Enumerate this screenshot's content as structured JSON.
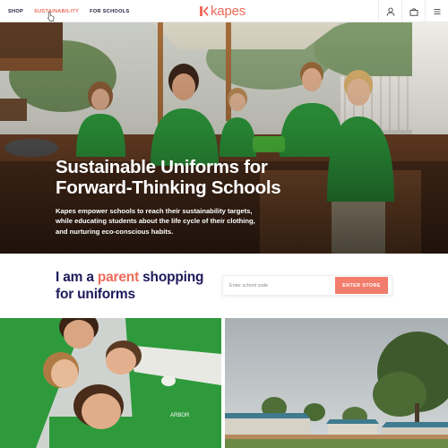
{
  "header": {
    "nav": [
      {
        "label": "SHOP",
        "active": false
      },
      {
        "label": "SUSTAINABILITY",
        "active": true
      },
      {
        "label": "FOR SCHOOLS",
        "active": false
      }
    ],
    "logo_text": "kapes",
    "icons": [
      "account-icon",
      "cart-icon",
      "menu-icon"
    ]
  },
  "hero": {
    "title_line1": "Sustainable Uniforms for",
    "title_line2": "Forward-Thinking Schools",
    "text_line1": "Kapes empower schools to reach their sustainability targets,",
    "text_line2": "while educating students about the life cycle of their clothing,",
    "text_line3": "and nurturing eco-conscious habits."
  },
  "parent_search": {
    "heading_before": "I am a ",
    "heading_highlight": "parent",
    "heading_after": " shopping",
    "heading_line2": "for uniforms",
    "input_placeholder": "Enter school code",
    "input_value": "",
    "button_label": "ENTER STORE"
  },
  "tiles": {
    "left_shirt_text": "ARBOR"
  },
  "colors": {
    "accent": "#ee6b5a",
    "button": "#f27d6d",
    "heading": "#1e1a5c",
    "nav_text": "#1c1c3a",
    "uniform_green": "#2e9a3c"
  }
}
